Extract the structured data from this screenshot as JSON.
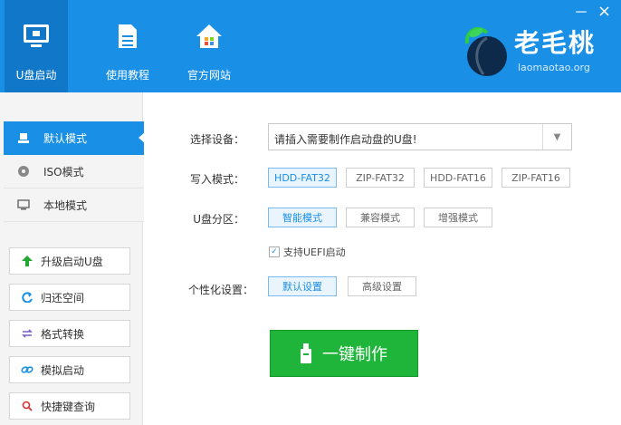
{
  "header": {
    "nav": [
      {
        "label": "U盘启动",
        "icon": "monitor-usb-icon"
      },
      {
        "label": "使用教程",
        "icon": "document-icon"
      },
      {
        "label": "官方网站",
        "icon": "home-icon"
      }
    ],
    "window": {
      "minimize": "－",
      "close": "×"
    },
    "logo": {
      "text": "老毛桃",
      "sub": "laomaotao.org"
    }
  },
  "sidebar": {
    "modes": [
      {
        "label": "默认模式",
        "icon": "usb-icon",
        "active": true
      },
      {
        "label": "ISO模式",
        "icon": "disc-icon",
        "active": false
      },
      {
        "label": "本地模式",
        "icon": "monitor-icon",
        "active": false
      }
    ],
    "tools": [
      {
        "label": "升级启动U盘",
        "icon": "arrow-up-icon",
        "color": "#20a830"
      },
      {
        "label": "归还空间",
        "icon": "refresh-icon",
        "color": "#1a8fe6"
      },
      {
        "label": "格式转换",
        "icon": "convert-icon",
        "color": "#7a5bd1"
      },
      {
        "label": "模拟启动",
        "icon": "link-icon",
        "color": "#1a8fe6"
      },
      {
        "label": "快捷键查询",
        "icon": "search-icon",
        "color": "#e03030"
      }
    ]
  },
  "main": {
    "device_label": "选择设备：",
    "device_value": "请插入需要制作启动盘的U盘!",
    "write_label": "写入模式：",
    "write_options": [
      "HDD-FAT32",
      "ZIP-FAT32",
      "HDD-FAT16",
      "ZIP-FAT16"
    ],
    "partition_label": "U盘分区：",
    "partition_options": [
      "智能模式",
      "兼容模式",
      "增强模式"
    ],
    "uefi_label": "支持UEFI启动",
    "personal_label": "个性化设置：",
    "personal_options": [
      "默认设置",
      "高级设置"
    ],
    "make_button": "一键制作"
  },
  "colors": {
    "accent": "#1a8fe6",
    "make": "#1fb53a"
  }
}
